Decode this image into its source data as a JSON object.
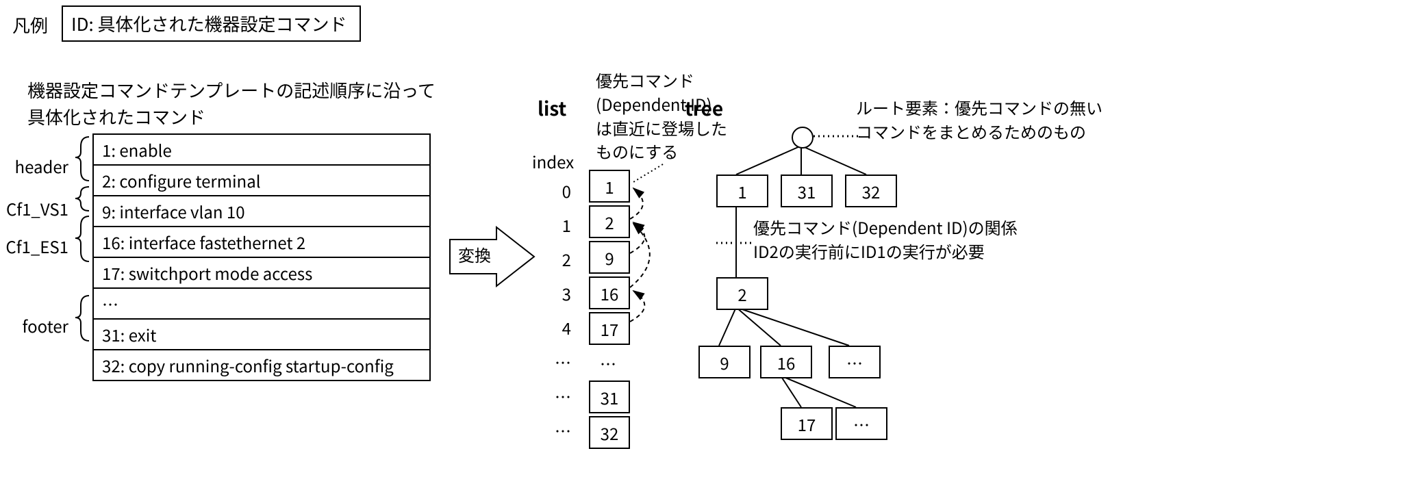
{
  "legend": {
    "label": "凡例",
    "box": "ID: 具体化された機器設定コマンド"
  },
  "left": {
    "desc_line1": "機器設定コマンドテンプレートの記述順序に沿って",
    "desc_line2": "具体化されたコマンド",
    "sections": [
      {
        "name": "header",
        "rows": [
          "1: enable",
          "2: configure terminal"
        ]
      },
      {
        "name": "Cf1_VS1",
        "rows": [
          "9: interface vlan 10"
        ]
      },
      {
        "name": "Cf1_ES1",
        "rows": [
          "16: interface fastethernet 2",
          "17: switchport mode access"
        ]
      },
      {
        "name": "",
        "rows": [
          "…"
        ]
      },
      {
        "name": "footer",
        "rows": [
          "31: exit",
          "32: copy running-config startup-config"
        ]
      }
    ]
  },
  "arrow": {
    "label": "変換"
  },
  "list": {
    "title": "list",
    "index_label": "index",
    "indices": [
      "0",
      "1",
      "2",
      "3",
      "4",
      "…",
      "…",
      "…"
    ],
    "cells": [
      "1",
      "2",
      "9",
      "16",
      "17",
      "…",
      "31",
      "32"
    ]
  },
  "tree": {
    "title": "tree",
    "nodes_level1": [
      "1",
      "31",
      "32"
    ],
    "node_under_1": "2",
    "nodes_under_2": [
      "9",
      "16",
      "…"
    ],
    "nodes_under_16": [
      "17",
      "…"
    ]
  },
  "annotations": {
    "dependent": "優先コマンド\n(Dependent ID)\nは直近に登場した\nものにする",
    "root": "ルート要素：優先コマンドの無い\nコマンドをまとめるためのもの",
    "relation": "優先コマンド(Dependent ID)の関係\nID2の実行前にID1の実行が必要"
  }
}
